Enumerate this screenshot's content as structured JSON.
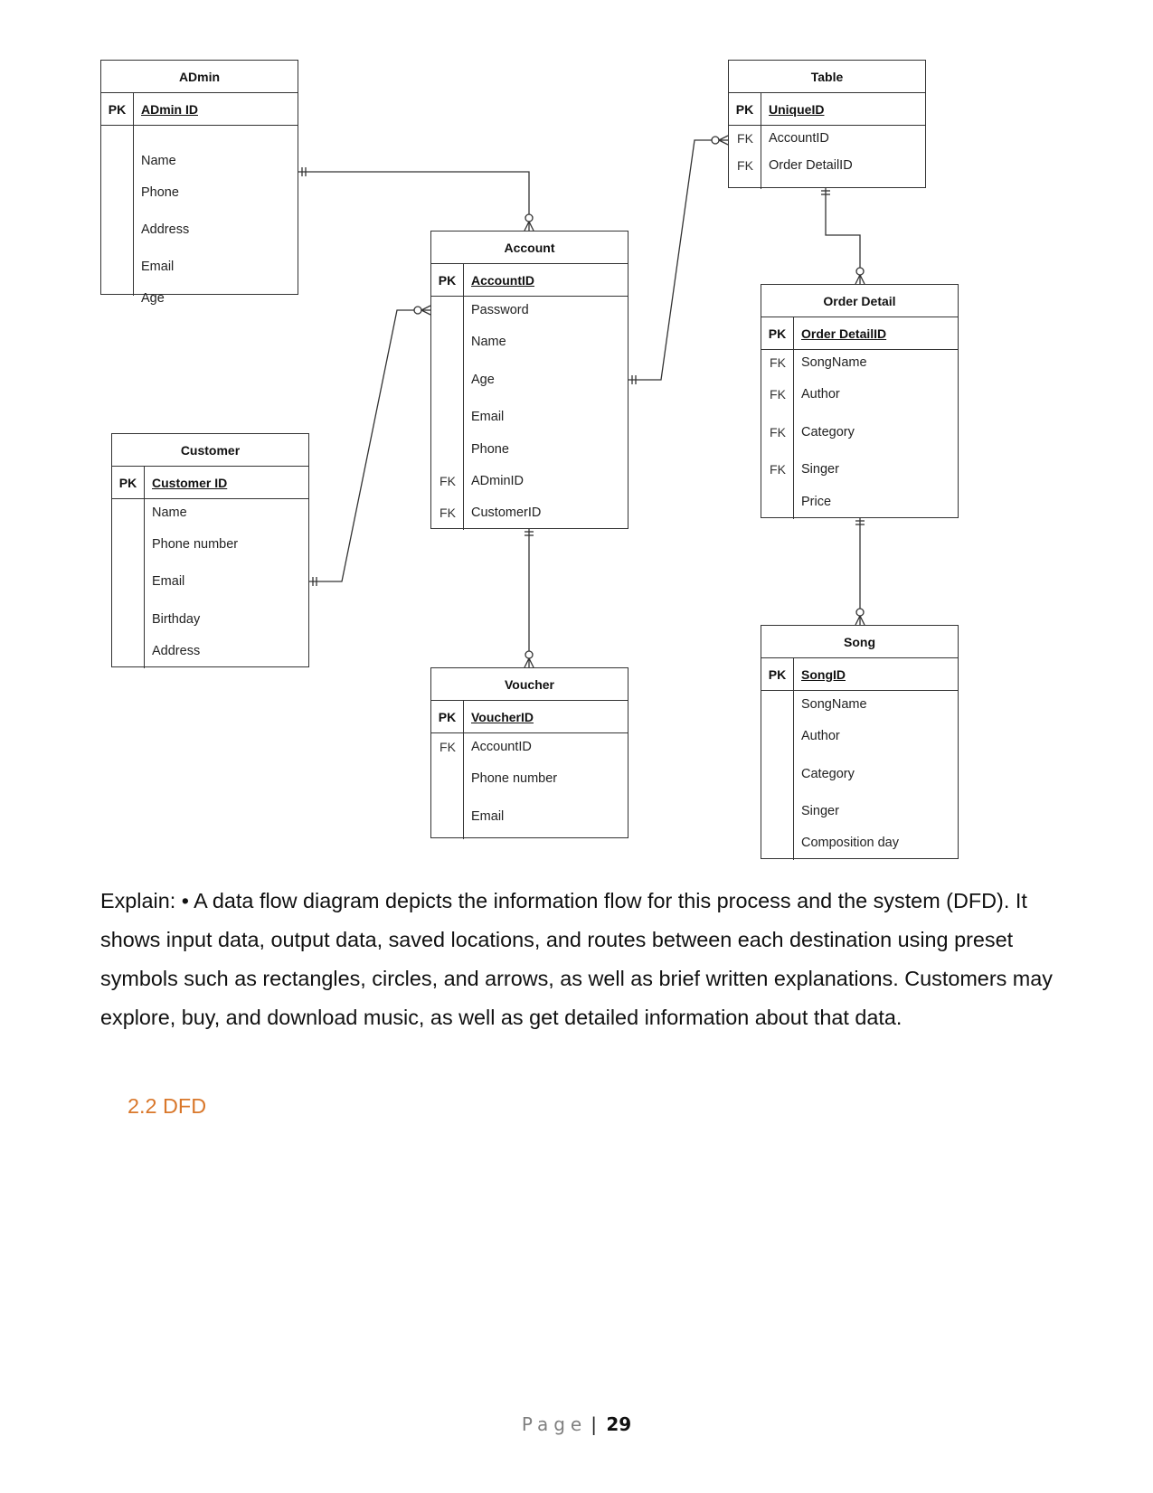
{
  "entities": {
    "admin": {
      "title": "ADmin",
      "pk_label": "PK",
      "pk": "ADmin ID",
      "attributes": [
        {
          "key": "",
          "name": "Name"
        },
        {
          "key": "",
          "name": "Phone"
        },
        {
          "key": "",
          "name": "Address"
        },
        {
          "key": "",
          "name": "Email"
        },
        {
          "key": "",
          "name": "Age"
        }
      ]
    },
    "table": {
      "title": "Table",
      "pk_label": "PK",
      "pk": "UniqueID",
      "attributes": [
        {
          "key": "FK",
          "name": "AccountID"
        },
        {
          "key": "FK",
          "name": "Order DetailID"
        }
      ]
    },
    "account": {
      "title": "Account",
      "pk_label": "PK",
      "pk": "AccountID",
      "attributes": [
        {
          "key": "",
          "name": "Password"
        },
        {
          "key": "",
          "name": "Name"
        },
        {
          "key": "",
          "name": "Age"
        },
        {
          "key": "",
          "name": "Email"
        },
        {
          "key": "",
          "name": "Phone"
        },
        {
          "key": "FK",
          "name": "ADminID"
        },
        {
          "key": "FK",
          "name": "CustomerID"
        }
      ]
    },
    "order_detail": {
      "title": "Order Detail",
      "pk_label": "PK",
      "pk": "Order DetailID",
      "attributes": [
        {
          "key": "FK",
          "name": "SongName"
        },
        {
          "key": "FK",
          "name": "Author"
        },
        {
          "key": "FK",
          "name": "Category"
        },
        {
          "key": "FK",
          "name": "Singer"
        },
        {
          "key": "",
          "name": "Price"
        }
      ]
    },
    "customer": {
      "title": "Customer",
      "pk_label": "PK",
      "pk": "Customer ID",
      "attributes": [
        {
          "key": "",
          "name": "Name"
        },
        {
          "key": "",
          "name": "Phone number"
        },
        {
          "key": "",
          "name": "Email"
        },
        {
          "key": "",
          "name": "Birthday"
        },
        {
          "key": "",
          "name": "Address"
        }
      ]
    },
    "voucher": {
      "title": "Voucher",
      "pk_label": "PK",
      "pk": "VoucherID",
      "attributes": [
        {
          "key": "FK",
          "name": "AccountID"
        },
        {
          "key": "",
          "name": "Phone number"
        },
        {
          "key": "",
          "name": "Email"
        }
      ]
    },
    "song": {
      "title": "Song",
      "pk_label": "PK",
      "pk": "SongID",
      "attributes": [
        {
          "key": "",
          "name": "SongName"
        },
        {
          "key": "",
          "name": "Author"
        },
        {
          "key": "",
          "name": "Category"
        },
        {
          "key": "",
          "name": "Singer"
        },
        {
          "key": "",
          "name": "Composition day"
        }
      ]
    }
  },
  "relationships": [
    {
      "from": "admin",
      "to": "account",
      "from_cardinality": "one-and-only-one",
      "to_cardinality": "zero-or-many"
    },
    {
      "from": "customer",
      "to": "account",
      "from_cardinality": "one-and-only-one",
      "to_cardinality": "zero-or-many"
    },
    {
      "from": "account",
      "to": "table",
      "from_cardinality": "one-and-only-one",
      "to_cardinality": "zero-or-many"
    },
    {
      "from": "table",
      "to": "order_detail",
      "from_cardinality": "one-and-only-one",
      "to_cardinality": "zero-or-many"
    },
    {
      "from": "account",
      "to": "voucher",
      "from_cardinality": "one-and-only-one",
      "to_cardinality": "zero-or-many"
    },
    {
      "from": "order_detail",
      "to": "song",
      "from_cardinality": "one-and-only-one",
      "to_cardinality": "zero-or-many"
    }
  ],
  "explain_text": "Explain: • A data flow diagram depicts the information flow for this process and the system (DFD). It shows input data, output data, saved locations, and routes between each destination using preset symbols such as rectangles, circles, and arrows, as well as brief written explanations. Customers may explore, buy, and download music, as well as get detailed information about that data.",
  "section_heading": "2.2 DFD",
  "footer": {
    "page_label": "Page",
    "separator": "|",
    "page_number": "29"
  },
  "colors": {
    "heading": "#d9772a",
    "footer_label": "#7f7f7f",
    "line": "#333333"
  }
}
